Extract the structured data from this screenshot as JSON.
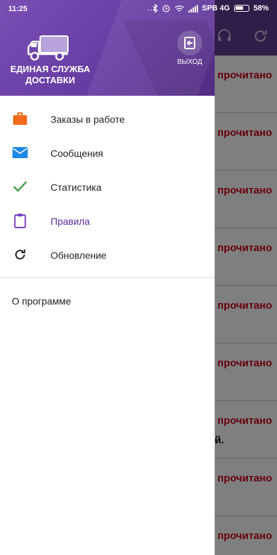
{
  "status_bar": {
    "time": "11:25",
    "dots": "...",
    "network": "SPB 4G",
    "battery": "58%"
  },
  "drawer": {
    "brand_line1": "ЕДИНАЯ СЛУЖБА",
    "brand_line2": "ДОСТАВКИ",
    "exit_label": "ВЫХОД",
    "items": [
      {
        "label": "Заказы в работе",
        "icon": "briefcase-icon",
        "color": "#f26b1d"
      },
      {
        "label": "Сообщения",
        "icon": "mail-icon",
        "color": "#1e88e5"
      },
      {
        "label": "Статистика",
        "icon": "check-icon",
        "color": "#43a047"
      },
      {
        "label": "Правила",
        "icon": "clipboard-icon",
        "color": "#7b3fbf"
      },
      {
        "label": "Обновление",
        "icon": "refresh-icon",
        "color": "#212121"
      }
    ],
    "about_label": "О программе"
  },
  "background": {
    "unread_label": "прочитано",
    "extra_text": "й."
  },
  "colors": {
    "header_purple": "#6a3fa6",
    "active_text": "#5b2aa0",
    "unread_red": "#d0021b"
  }
}
